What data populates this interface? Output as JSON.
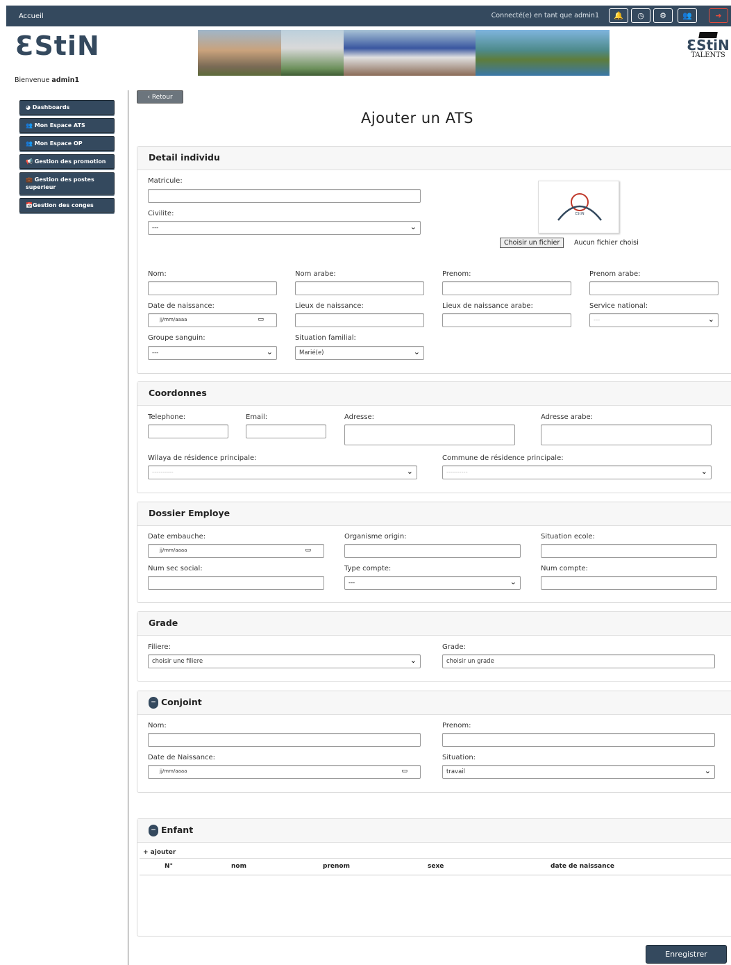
{
  "topbar": {
    "home": "Accueil",
    "connected": "Connecté(e) en tant que admin1",
    "icons": [
      "bell-icon",
      "clock-icon",
      "gear-icon",
      "users-icon",
      "logout-icon"
    ]
  },
  "logo": {
    "text": "ƐStiN",
    "right_t1": "ƐStiN",
    "right_t2": "TALENTS"
  },
  "welcome": {
    "prefix": "Bienvenue",
    "user": "admin1"
  },
  "sidebar": {
    "items": [
      {
        "label": "Dashboards"
      },
      {
        "label": "Mon Espace ATS"
      },
      {
        "label": "Mon Espace OP"
      },
      {
        "label": "Gestion des promotion"
      },
      {
        "label": "Gestion des postes superieur"
      },
      {
        "label": "Gestion des conges"
      }
    ]
  },
  "retour": "Retour",
  "title": "Ajouter un ATS",
  "detail": {
    "header": "Detail individu",
    "matricule": "Matricule:",
    "civilite": "Civilite:",
    "civilite_value": "---",
    "choose_file": "Choisir un fichier",
    "no_file": "Aucun fichier choisi",
    "photo_text": "ƐStiN",
    "nom": "Nom:",
    "nom_arabe": "Nom arabe:",
    "prenom": "Prenom:",
    "prenom_arabe": "Prenom arabe:",
    "date_naissance": "Date de naissance:",
    "date_placeholder": "jj/mm/aaaa",
    "lieux_naissance": "Lieux de naissance:",
    "lieux_naissance_arabe": "Lieux de naissance arabe:",
    "service_national": "Service national:",
    "service_value": "---",
    "groupe_sanguin": "Groupe sanguin:",
    "groupe_value": "---",
    "situation_familial": "Situation familial:",
    "situation_value": "Marié(e)"
  },
  "coord": {
    "header": "Coordonnes",
    "telephone": "Telephone:",
    "email": "Email:",
    "adresse": "Adresse:",
    "adresse_arabe": "Adresse arabe:",
    "wilaya": "Wilaya de résidence principale:",
    "commune": "Commune de résidence principale:",
    "placeholder": "----------"
  },
  "dossier": {
    "header": "Dossier Employe",
    "date_embauche": "Date embauche:",
    "date_placeholder": "jj/mm/aaaa",
    "organisme": "Organisme origin:",
    "situation_ecole": "Situation ecole:",
    "num_sec": "Num sec social:",
    "type_compte": "Type compte:",
    "type_value": "---",
    "num_compte": "Num compte:"
  },
  "grade": {
    "header": "Grade",
    "filiere": "Filiere:",
    "filiere_value": "choisir une filiere",
    "grade": "Grade:",
    "grade_value": "choisir un grade"
  },
  "conjoint": {
    "header": "Conjoint",
    "nom": "Nom:",
    "prenom": "Prenom:",
    "date": "Date de Naissance:",
    "date_placeholder": "jj/mm/aaaa",
    "situation": "Situation:",
    "situation_value": "travail"
  },
  "enfant": {
    "header": "Enfant",
    "add": "+ ajouter",
    "columns": [
      "N°",
      "nom",
      "prenom",
      "sexe",
      "date de naissance"
    ]
  },
  "save": "Enregistrer",
  "colors": {
    "primary": "#34495e",
    "accent": "#c0392b"
  }
}
